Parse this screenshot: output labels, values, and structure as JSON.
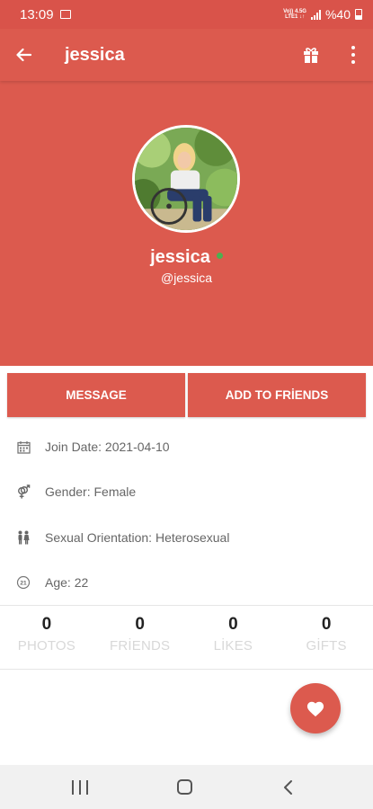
{
  "status_bar": {
    "time": "13:09",
    "network_top": "Vo)) 4.5G",
    "network_bottom": "LTE1 ↓↑",
    "battery": "%40",
    "icons": [
      "image-icon",
      "signal-icon",
      "battery-icon"
    ]
  },
  "app_bar": {
    "title": "jessica",
    "icons": [
      "back-arrow-icon",
      "gift-icon",
      "more-vert-icon"
    ]
  },
  "profile": {
    "display_name": "jessica",
    "username": "@jessica",
    "online": true
  },
  "actions": {
    "message_label": "MESSAGE",
    "add_friend_label": "ADD TO FRİENDS"
  },
  "info": {
    "join_date": "Join Date: 2021-04-10",
    "gender": "Gender: Female",
    "orientation": "Sexual Orientation: Heterosexual",
    "age": "Age: 22",
    "age_icon_text": "21",
    "icons": [
      "calendar-icon",
      "gender-icon",
      "people-icon",
      "age-icon"
    ]
  },
  "stats": [
    {
      "value": "0",
      "label": "PHOTOS"
    },
    {
      "value": "0",
      "label": "FRİENDS"
    },
    {
      "value": "0",
      "label": "LİKES"
    },
    {
      "value": "0",
      "label": "GİFTS"
    }
  ],
  "fab": {
    "icon": "heart-icon"
  },
  "colors": {
    "primary": "#dc5a4e",
    "status_bar": "#d9534a",
    "online": "#4caf50",
    "muted_label": "#d8d8d8"
  }
}
